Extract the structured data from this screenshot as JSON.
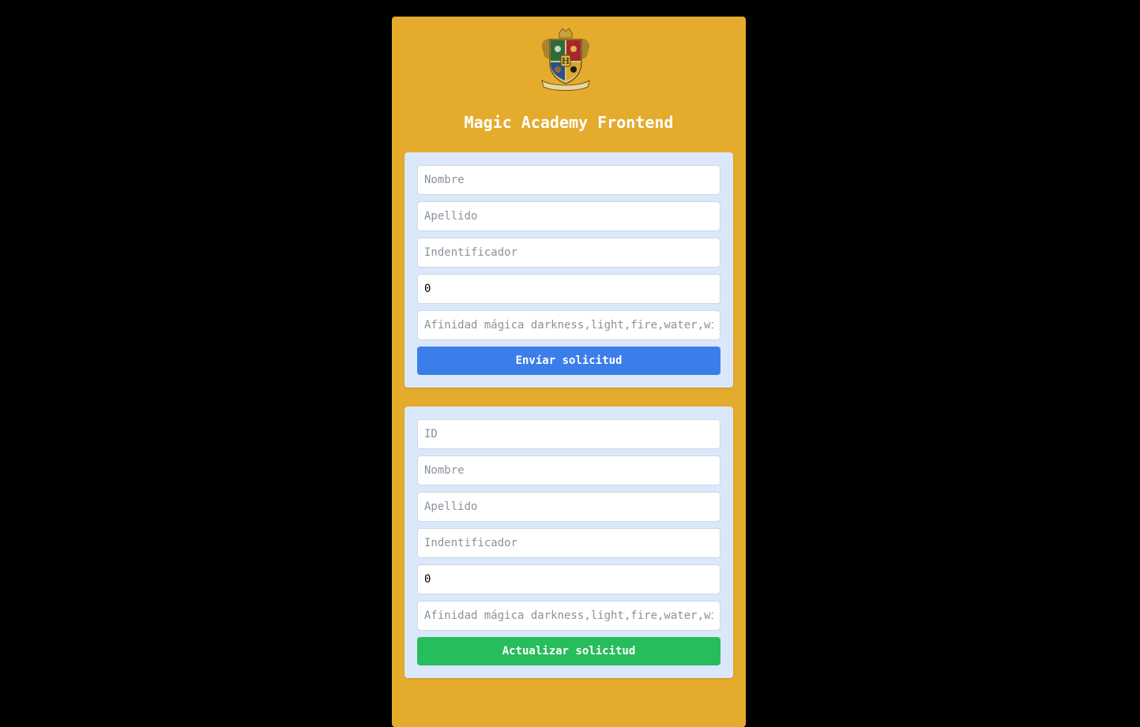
{
  "app": {
    "title": "Magic Academy Frontend",
    "crest_letter": "H"
  },
  "create_form": {
    "nombre_placeholder": "Nombre",
    "apellido_placeholder": "Apellido",
    "identificador_placeholder": "Indentificador",
    "edad_value": "0",
    "afinidad_placeholder": "Afinidad mágica darkness,light,fire,water,wind",
    "submit_label": "Envíar solicitud"
  },
  "update_form": {
    "id_placeholder": "ID",
    "nombre_placeholder": "Nombre",
    "apellido_placeholder": "Apellido",
    "identificador_placeholder": "Indentificador",
    "edad_value": "0",
    "afinidad_placeholder": "Afinidad mágica darkness,light,fire,water,wind",
    "submit_label": "Actualizar solicitud"
  },
  "colors": {
    "background": "#000000",
    "card": "#e5ab2d",
    "panel": "#dbe8fb",
    "primary_button": "#3b7ee9",
    "success_button": "#27bd5d"
  },
  "icons": {
    "crest": "hogwarts-crest-icon"
  }
}
